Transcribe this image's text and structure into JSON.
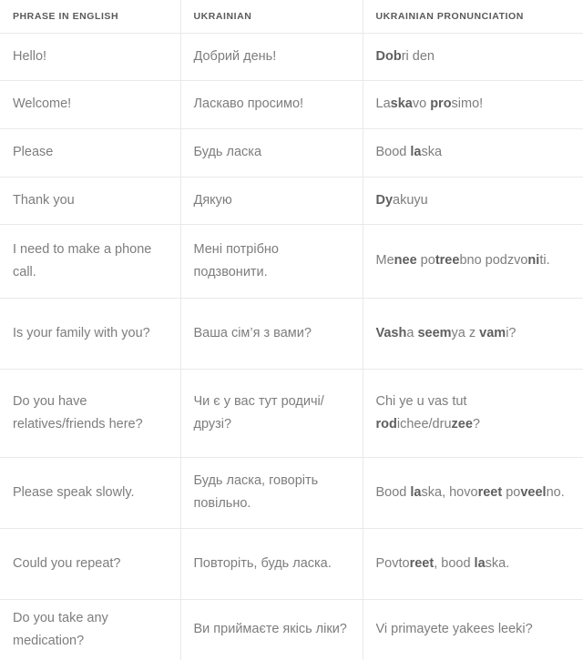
{
  "table": {
    "columns": [
      {
        "key": "english",
        "label": "PHRASE IN ENGLISH"
      },
      {
        "key": "ukrainian",
        "label": "UKRAINIAN"
      },
      {
        "key": "pronunciation",
        "label": "UKRAINIAN PRONUNCIATION"
      }
    ],
    "rows": [
      {
        "english": "Hello!",
        "ukrainian": "Добрий день!",
        "pronunciation": "Dobri den",
        "pronunciation_html": "<b>Dob</b>ri den"
      },
      {
        "english": "Welcome!",
        "ukrainian": "Ласкаво просимо!",
        "pronunciation": "Laskavo prosimo!",
        "pronunciation_html": "La<b>ska</b>vo <b>pro</b>simo!"
      },
      {
        "english": "Please",
        "ukrainian": "Будь ласка",
        "pronunciation": "Bood laska",
        "pronunciation_html": "Bood <b>la</b>ska"
      },
      {
        "english": "Thank you",
        "ukrainian": "Дякую",
        "pronunciation": "Dyakuyu",
        "pronunciation_html": "<b>Dy</b>akuyu"
      },
      {
        "english": "I need to make a phone call.",
        "ukrainian": "Мені потрібно подзвонити.",
        "pronunciation": "Menee potreebno podzvoniti.",
        "pronunciation_html": "Me<b>nee</b> po<b>tree</b>bno podzvo<b>ni</b>ti."
      },
      {
        "english": "Is your family with you?",
        "ukrainian": "Ваша сім’я з вами?",
        "pronunciation": "Vasha seemya z vami?",
        "pronunciation_html": "<b>Vash</b>a <b>seem</b>ya z <b>vam</b>i?"
      },
      {
        "english": "Do you have relatives/friends here?",
        "ukrainian": "Чи є у вас тут родичі/друзі?",
        "pronunciation": "Chi ye u vas tut rodichee/druzee?",
        "pronunciation_html": "Chi ye u vas tut <b>rod</b>ichee/dru<b>zee</b>?"
      },
      {
        "english": "Please speak slowly.",
        "ukrainian": "Будь ласка, говоріть повільно.",
        "pronunciation": "Bood laska, hovoreet poveelno.",
        "pronunciation_html": "Bood <b>la</b>ska, hovo<b>reet</b> po<b>veel</b>no."
      },
      {
        "english": "Could you repeat?",
        "ukrainian": "Повторіть, будь ласка.",
        "pronunciation": "Povtoreet, bood laska.",
        "pronunciation_html": "Povto<b>reet</b>, bood <b>la</b>ska."
      },
      {
        "english": "Do you take any medication?",
        "ukrainian": "Ви приймаєте якісь ліки?",
        "pronunciation": "Vi primayete yakees leeki?",
        "pronunciation_html": "Vi primayete yakees leeki?"
      }
    ]
  },
  "colors": {
    "border": "#e9e9e9",
    "header_text": "#5a5a5a",
    "body_text": "#7d7d7d",
    "bold_text": "#5f5f5f",
    "background": "#ffffff"
  }
}
